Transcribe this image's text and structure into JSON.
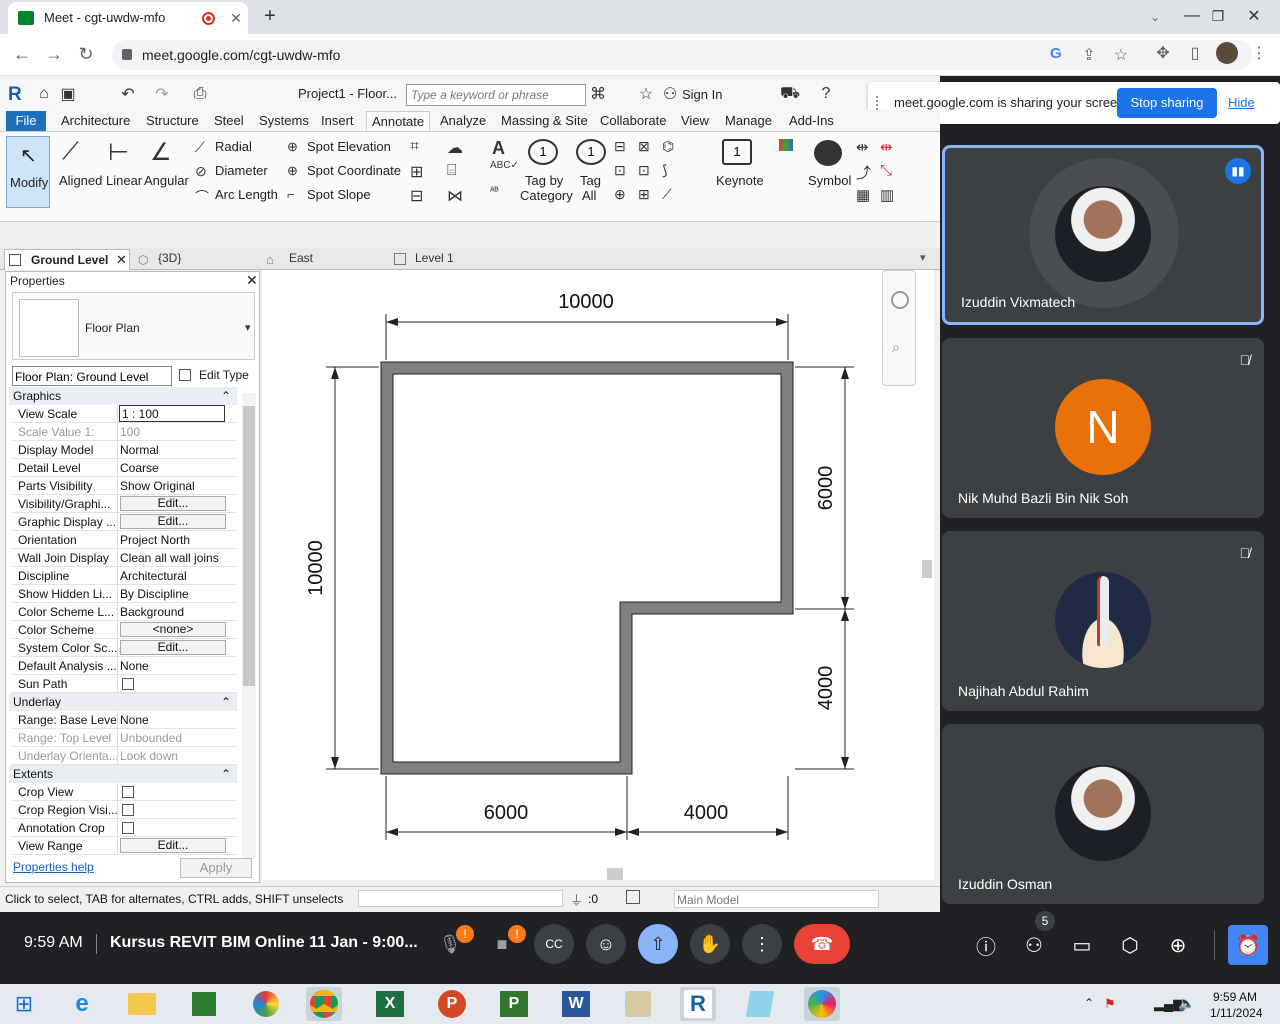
{
  "browser": {
    "tab_title": "Meet - cgt-uwdw-mfo",
    "url": "meet.google.com/cgt-uwdw-mfo",
    "new_tab": "+"
  },
  "revit": {
    "title": "Project1 - Floor...",
    "search_placeholder": "Type a keyword or phrase",
    "sign_in": "Sign In",
    "menu": [
      "File",
      "Architecture",
      "Structure",
      "Steel",
      "Systems",
      "Insert",
      "Annotate",
      "Analyze",
      "Massing & Site",
      "Collaborate",
      "View",
      "Manage",
      "Add-Ins"
    ],
    "active_menu": "Annotate",
    "ribbon": {
      "modify": "Modify",
      "aligned": "Aligned",
      "linear": "Linear",
      "angular": "Angular",
      "radial": "Radial",
      "diameter": "Diameter",
      "arc_length": "Arc Length",
      "spot_elevation": "Spot Elevation",
      "spot_coordinate": "Spot Coordinate",
      "spot_slope": "Spot Slope",
      "tag_by_category_1": "Tag by",
      "tag_by_category_2": "Category",
      "tag_all_1": "Tag",
      "tag_all_2": "All",
      "keynote": "Keynote",
      "symbol": "Symbol"
    },
    "view_tabs": [
      "Ground Level",
      "{3D}",
      "East",
      "Level 1"
    ],
    "properties": {
      "header": "Properties",
      "type": "Floor Plan",
      "selector": "Floor Plan: Ground Level",
      "edit_type": "Edit Type",
      "groups": {
        "graphics": "Graphics",
        "underlay": "Underlay",
        "extents": "Extents"
      },
      "rows": [
        {
          "k": "View Scale",
          "v": "1 : 100"
        },
        {
          "k": "Scale Value    1:",
          "v": "100"
        },
        {
          "k": "Display Model",
          "v": "Normal"
        },
        {
          "k": "Detail Level",
          "v": "Coarse"
        },
        {
          "k": "Parts Visibility",
          "v": "Show Original"
        },
        {
          "k": "Visibility/Graphi...",
          "v": "Edit..."
        },
        {
          "k": "Graphic Display ...",
          "v": "Edit..."
        },
        {
          "k": "Orientation",
          "v": "Project North"
        },
        {
          "k": "Wall Join Display",
          "v": "Clean all wall joins"
        },
        {
          "k": "Discipline",
          "v": "Architectural"
        },
        {
          "k": "Show Hidden Li...",
          "v": "By Discipline"
        },
        {
          "k": "Color Scheme L...",
          "v": "Background"
        },
        {
          "k": "Color Scheme",
          "v": "<none>"
        },
        {
          "k": "System Color Sc...",
          "v": "Edit..."
        },
        {
          "k": "Default Analysis ...",
          "v": "None"
        },
        {
          "k": "Sun Path",
          "v": ""
        },
        {
          "k": "Range: Base Level",
          "v": "None"
        },
        {
          "k": "Range: Top Level",
          "v": "Unbounded"
        },
        {
          "k": "Underlay Orienta...",
          "v": "Look down"
        },
        {
          "k": "Crop View",
          "v": ""
        },
        {
          "k": "Crop Region Visi...",
          "v": ""
        },
        {
          "k": "Annotation Crop",
          "v": ""
        },
        {
          "k": "View Range",
          "v": "Edit..."
        }
      ],
      "help": "Properties help",
      "apply": "Apply"
    },
    "dimensions": {
      "top": "10000",
      "left": "10000",
      "right_top": "6000",
      "right_bottom": "4000",
      "bottom_left": "6000",
      "bottom_right": "4000"
    },
    "status": {
      "hint": "Click to select, TAB for alternates, CTRL adds, SHIFT unselects",
      "count": ":0",
      "model": "Main Model"
    }
  },
  "meet": {
    "share_banner": "meet.google.com is sharing your screen.",
    "stop_sharing": "Stop sharing",
    "hide": "Hide",
    "participants": [
      {
        "name": "Izuddin Vixmatech",
        "speaking": true
      },
      {
        "name": "Nik Muhd Bazli Bin Nik Soh",
        "initial": "N",
        "muted": true
      },
      {
        "name": "Najihah Abdul Rahim",
        "muted": true
      },
      {
        "name": "Izuddin Osman"
      }
    ],
    "time": "9:59 AM",
    "meeting_title": "Kursus REVIT BIM Online 11 Jan - 9:00...",
    "people_count": "5",
    "colors": {
      "leave": "#ea4335",
      "present": "#8ab4f8",
      "accent": "#1a73e8",
      "orange_avatar": "#e8710a"
    }
  },
  "taskbar": {
    "clock_time": "9:59 AM",
    "clock_date": "1/11/2024"
  }
}
